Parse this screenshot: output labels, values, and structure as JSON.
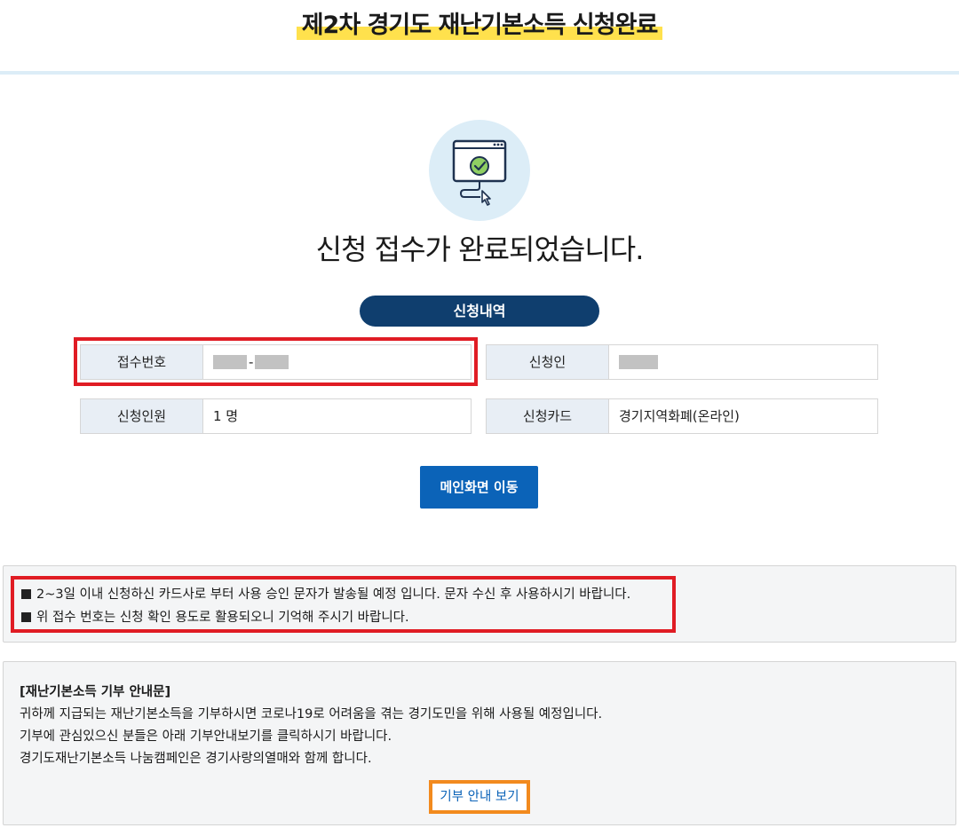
{
  "header": {
    "title": "제2차 경기도 재난기본소득 신청완료"
  },
  "status": {
    "icon": "browser-check-icon",
    "message": "신청 접수가 완료되었습니다."
  },
  "section_label": "신청내역",
  "fields": [
    {
      "label": "접수번호",
      "value": "",
      "blurred": true
    },
    {
      "label": "신청인",
      "value": "",
      "blurred": true
    },
    {
      "label": "신청인원",
      "value": "1 명"
    },
    {
      "label": "신청카드",
      "value": "경기지역화폐(온라인)"
    }
  ],
  "main_button": "메인화면 이동",
  "notice": {
    "lines": [
      "2~3일 이내 신청하신 카드사로 부터 사용 승인 문자가 발송될 예정 입니다. 문자 수신 후 사용하시기 바랍니다.",
      "위 접수 번호는 신청 확인 용도로 활용되오니 기억해 주시기 바랍니다."
    ]
  },
  "donation": {
    "title": "[재난기본소득 기부 안내문]",
    "lines": [
      "귀하께 지급되는 재난기본소득을 기부하시면 코로나19로 어려움을 겪는 경기도민을 위해 사용될 예정입니다.",
      "기부에 관심있으신 분들은 아래 기부안내보기를 클릭하시기 바랍니다.",
      "경기도재난기본소득 나눔캠페인은 경기사랑의열매와 함께 합니다."
    ],
    "button": "기부 안내 보기"
  },
  "colors": {
    "highlight": "#ffe14d",
    "pill": "#0f3e6e",
    "primary_button": "#0b63b8",
    "annotation_red": "#e01c24",
    "annotation_orange": "#f28a1e",
    "label_bg": "#e8eef5"
  }
}
